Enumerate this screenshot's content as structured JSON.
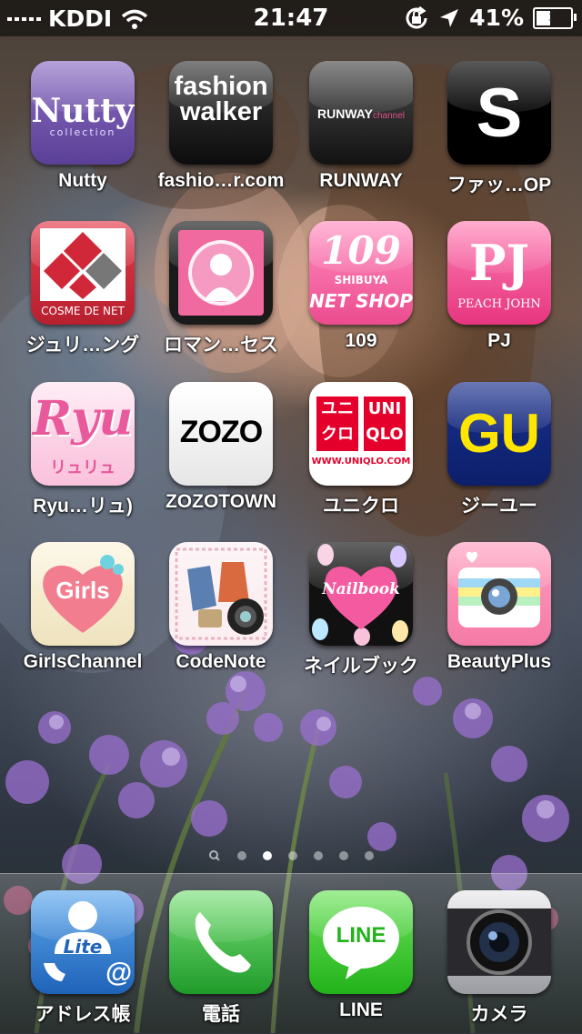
{
  "status_bar": {
    "carrier": "KDDI",
    "time": "21:47",
    "battery_percent": "41%",
    "battery_level": 0.41
  },
  "apps": [
    {
      "name": "Nutty",
      "icon": "nutty-app-icon",
      "text": "Nutty",
      "subtext": "collection"
    },
    {
      "name": "fashio…r.com",
      "icon": "fashionwalker-app-icon",
      "text": "fashion",
      "text2": "walker",
      ".com": ".com"
    },
    {
      "name": "RUNWAY",
      "icon": "runway-app-icon",
      "text": "RUNWAY",
      "subtext": "channel"
    },
    {
      "name": "ファッ…OP",
      "icon": "shop-s-app-icon",
      "text": "S"
    },
    {
      "name": "ジュリ…ング",
      "icon": "cosme-de-net-app-icon",
      "text": "COSME DE NET"
    },
    {
      "name": "ロマン…セス",
      "icon": "romance-princess-app-icon"
    },
    {
      "name": "109",
      "icon": "shibuya109-app-icon",
      "text": "109",
      "text2": "SHIBUYA",
      "text3": "NET SHOP"
    },
    {
      "name": "PJ",
      "icon": "peach-john-app-icon",
      "text": "PJ",
      "text2": "PEACH JOHN"
    },
    {
      "name": "Ryu…リュ)",
      "icon": "ryuryu-app-icon",
      "text": "Ryu",
      "text2": "リュリュ"
    },
    {
      "name": "ZOZOTOWN",
      "icon": "zozotown-app-icon",
      "text": "ZOZO"
    },
    {
      "name": "ユニクロ",
      "icon": "uniqlo-app-icon",
      "text": "ユニ",
      "text2": "UNI",
      "text3": "クロ",
      "text4": "QLO",
      "text5": "WWW.UNIQLO.COM"
    },
    {
      "name": "ジーユー",
      "icon": "gu-app-icon",
      "text": "GU"
    },
    {
      "name": "GirlsChannel",
      "icon": "girlschannel-app-icon",
      "text": "Girls"
    },
    {
      "name": "CodeNote",
      "icon": "codenote-app-icon"
    },
    {
      "name": "ネイルブック",
      "icon": "nailbook-app-icon",
      "text": "Nailbook"
    },
    {
      "name": "BeautyPlus",
      "icon": "beautyplus-app-icon"
    }
  ],
  "page_dots": {
    "count": 6,
    "active_index": 1
  },
  "dock": [
    {
      "name": "アドレス帳",
      "icon": "address-book-app-icon",
      "text": "Lite"
    },
    {
      "name": "電話",
      "icon": "phone-app-icon"
    },
    {
      "name": "LINE",
      "icon": "line-app-icon",
      "text": "LINE"
    },
    {
      "name": "カメラ",
      "icon": "camera-app-icon"
    }
  ]
}
